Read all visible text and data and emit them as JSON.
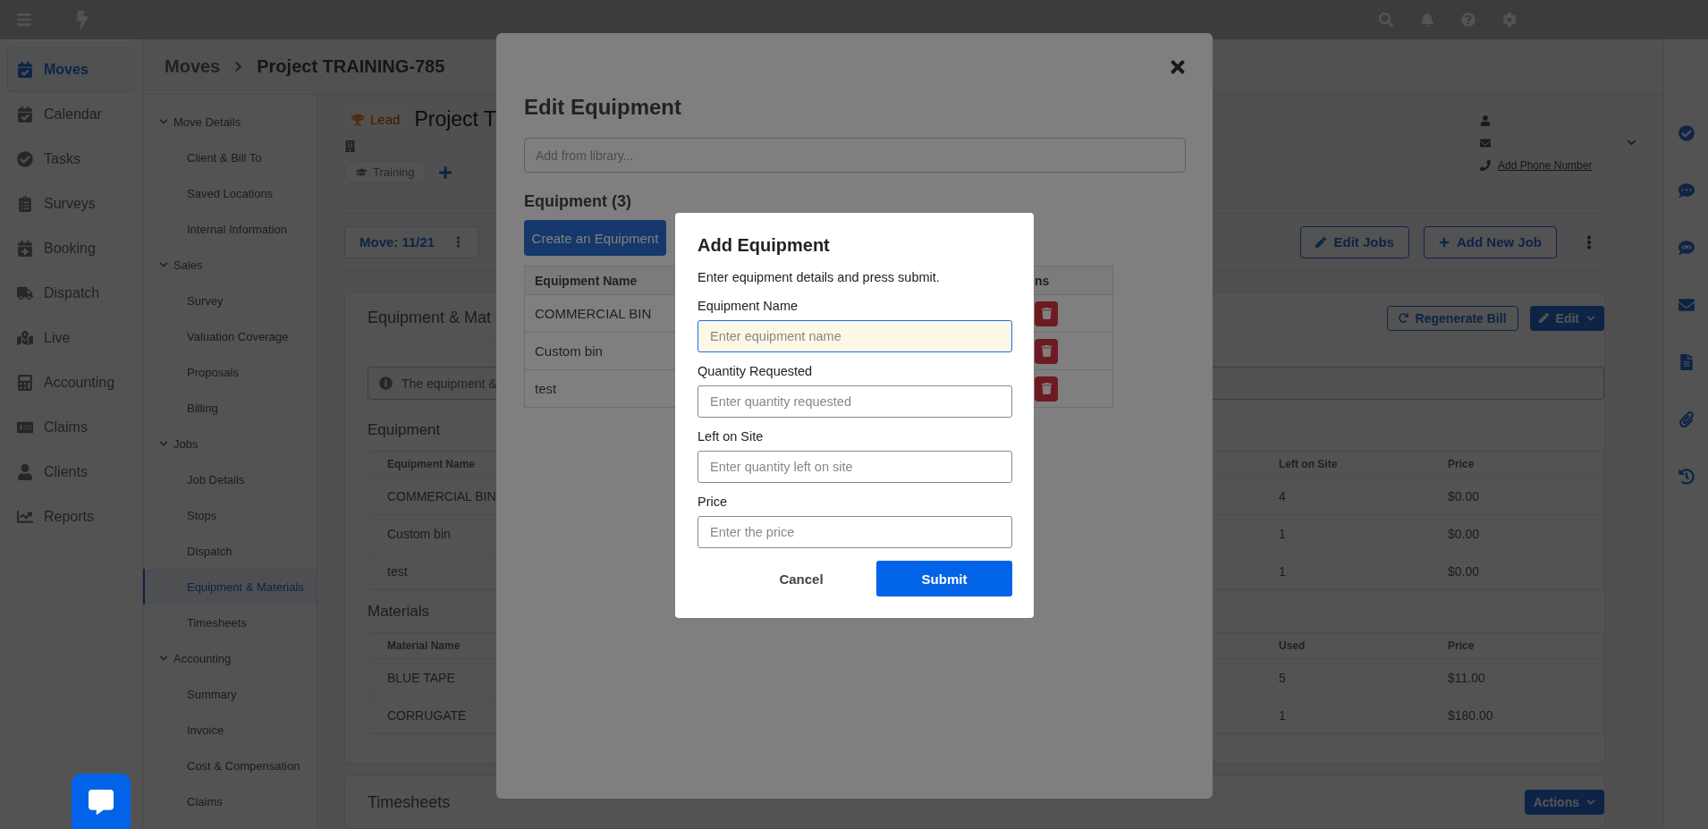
{
  "nav": [
    {
      "label": "Moves",
      "selected": true
    },
    {
      "label": "Calendar",
      "selected": false
    },
    {
      "label": "Tasks",
      "selected": false
    },
    {
      "label": "Surveys",
      "selected": false
    },
    {
      "label": "Booking",
      "selected": false
    },
    {
      "label": "Dispatch",
      "selected": false
    },
    {
      "label": "Live",
      "selected": false
    },
    {
      "label": "Accounting",
      "selected": false
    },
    {
      "label": "Claims",
      "selected": false
    },
    {
      "label": "Clients",
      "selected": false
    },
    {
      "label": "Reports",
      "selected": false
    }
  ],
  "breadcrumb": {
    "parent": "Moves",
    "current": "Project TRAINING-785"
  },
  "subnav": [
    {
      "label": "Move Details",
      "expanded": true,
      "children": [
        {
          "label": "Client & Bill To",
          "selected": false
        },
        {
          "label": "Saved Locations",
          "selected": false
        },
        {
          "label": "Internal Information",
          "selected": false
        }
      ]
    },
    {
      "label": "Sales",
      "expanded": true,
      "children": [
        {
          "label": "Survey",
          "selected": false
        },
        {
          "label": "Valuation Coverage",
          "selected": false
        },
        {
          "label": "Proposals",
          "selected": false
        },
        {
          "label": "Billing",
          "selected": false
        }
      ]
    },
    {
      "label": "Jobs",
      "expanded": true,
      "children": [
        {
          "label": "Job Details",
          "selected": false
        },
        {
          "label": "Stops",
          "selected": false
        },
        {
          "label": "Dispatch",
          "selected": false
        },
        {
          "label": "Equipment & Materials",
          "selected": true
        },
        {
          "label": "Timesheets",
          "selected": false
        }
      ]
    },
    {
      "label": "Accounting",
      "expanded": true,
      "children": [
        {
          "label": "Summary",
          "selected": false
        },
        {
          "label": "Invoice",
          "selected": false
        },
        {
          "label": "Cost & Compensation",
          "selected": false
        },
        {
          "label": "Claims",
          "selected": false
        }
      ]
    }
  ],
  "project": {
    "status": "Lead",
    "title": "Project T",
    "tag": "Training",
    "move_tab": "Move: 11/21",
    "phone_link": "Add Phone Number"
  },
  "job_buttons": [
    "Edit Jobs",
    "Add New Job"
  ],
  "section": {
    "title": "Equipment & Mat",
    "buttons": [
      "Regenerate Bill",
      "Edit"
    ],
    "info": "The equipment &",
    "tables": [
      {
        "heading": "Equipment",
        "columns": [
          "Equipment Name",
          "Left on Site",
          "Price"
        ],
        "rows": [
          [
            "COMMERCIAL BIN",
            "4",
            "$0.00"
          ],
          [
            "Custom bin",
            "1",
            "$0.00"
          ],
          [
            "test",
            "1",
            "$0.00"
          ]
        ]
      },
      {
        "heading": "Materials",
        "columns": [
          "Material Name",
          "Used",
          "Price"
        ],
        "rows": [
          [
            "BLUE TAPE",
            "5",
            "$11.00"
          ],
          [
            "CORRUGATE",
            "1",
            "$180.00"
          ]
        ]
      }
    ]
  },
  "timesheets": {
    "title": "Timesheets",
    "button": "Actions"
  },
  "edit_modal": {
    "title": "Edit Equipment",
    "search_placeholder": "Add from library...",
    "list_title": "Equipment (3)",
    "create_button": "Create an Equipment",
    "columns": [
      "Equipment Name",
      "ns"
    ],
    "rows": [
      "COMMERCIAL BIN",
      "Custom bin",
      "test"
    ]
  },
  "add_modal": {
    "title": "Add Equipment",
    "description": "Enter equipment details and press submit.",
    "fields": [
      {
        "label": "Equipment Name",
        "placeholder": "Enter equipment name",
        "focused": true
      },
      {
        "label": "Quantity Requested",
        "placeholder": "Enter quantity requested",
        "focused": false
      },
      {
        "label": "Left on Site",
        "placeholder": "Enter quantity left on site",
        "focused": false
      },
      {
        "label": "Price",
        "placeholder": "Enter the price",
        "focused": false
      }
    ],
    "cancel": "Cancel",
    "submit": "Submit"
  }
}
